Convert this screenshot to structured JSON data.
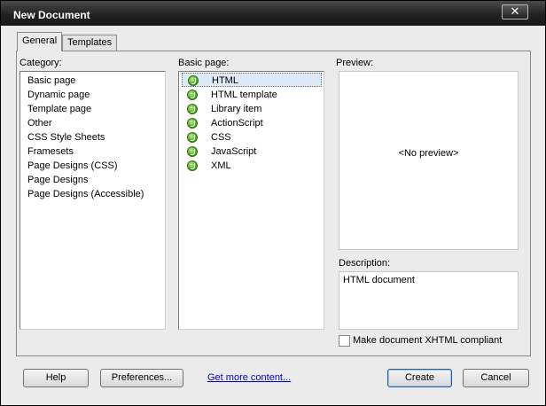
{
  "window": {
    "title": "New Document",
    "close_label": "✕"
  },
  "tabs": [
    {
      "label": "General"
    },
    {
      "label": "Templates"
    }
  ],
  "category": {
    "label": "Category:",
    "items": [
      "Basic page",
      "Dynamic page",
      "Template page",
      "Other",
      "CSS Style Sheets",
      "Framesets",
      "Page Designs (CSS)",
      "Page Designs",
      "Page Designs (Accessible)"
    ]
  },
  "basic_page": {
    "label": "Basic page:",
    "selected": "HTML",
    "items": [
      "HTML",
      "HTML template",
      "Library item",
      "ActionScript",
      "CSS",
      "JavaScript",
      "XML"
    ]
  },
  "preview": {
    "label": "Preview:",
    "placeholder": "<No preview>"
  },
  "description": {
    "label": "Description:",
    "text": "HTML document"
  },
  "xhtml": {
    "label": "Make document XHTML compliant",
    "checked": false
  },
  "buttons": {
    "help": "Help",
    "preferences": "Preferences...",
    "get_more": "Get more content...",
    "create": "Create",
    "cancel": "Cancel"
  }
}
